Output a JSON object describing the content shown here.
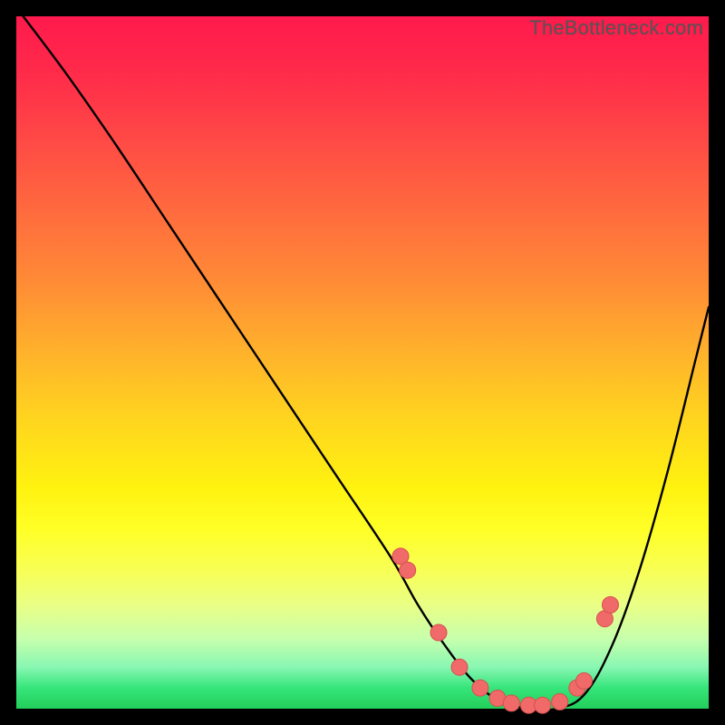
{
  "watermark": "TheBottleneck.com",
  "colors": {
    "background": "#000000",
    "curve_stroke": "#000000",
    "dot_fill": "#f06a6a",
    "dot_stroke": "#d84f4f"
  },
  "chart_data": {
    "type": "line",
    "title": "",
    "xlabel": "",
    "ylabel": "",
    "xlim": [
      0,
      100
    ],
    "ylim": [
      0,
      100
    ],
    "grid": false,
    "legend": false,
    "series": [
      {
        "name": "bottleneck-curve",
        "x": [
          1,
          7,
          14,
          22,
          30,
          38,
          46,
          54,
          58,
          62,
          66,
          70,
          74,
          78,
          82,
          86,
          90,
          94,
          98,
          100
        ],
        "y": [
          100,
          92,
          82,
          70,
          58,
          46,
          34,
          22,
          15,
          9,
          4,
          1,
          0,
          0,
          2,
          9,
          20,
          34,
          50,
          58
        ]
      }
    ],
    "markers": {
      "name": "curve-dots",
      "x": [
        55.5,
        56.5,
        61,
        64,
        67,
        69.5,
        71.5,
        74,
        76,
        78.5,
        81,
        82,
        85,
        85.8
      ],
      "y": [
        22,
        20,
        11,
        6,
        3,
        1.5,
        0.8,
        0.5,
        0.5,
        1,
        3,
        4,
        13,
        15
      ]
    }
  }
}
